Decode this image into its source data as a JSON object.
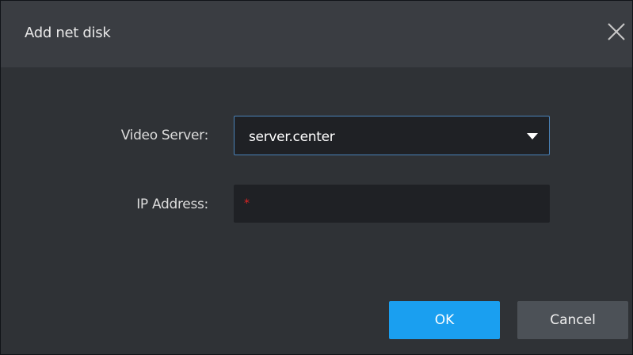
{
  "dialog": {
    "title": "Add net disk",
    "close_icon": "close-icon"
  },
  "form": {
    "video_server": {
      "label": "Video Server:",
      "selected": "server.center",
      "dropdown_icon": "caret-down-icon"
    },
    "ip_address": {
      "label": "IP Address:",
      "value": "",
      "required_marker": "*"
    }
  },
  "buttons": {
    "ok": "OK",
    "cancel": "Cancel"
  },
  "colors": {
    "dialog_bg": "#2f3236",
    "title_bar_bg": "#3a3d42",
    "input_bg": "#1f2125",
    "focus_border": "#4a82b8",
    "primary": "#1a9ff0",
    "secondary": "#4c5157",
    "required": "#e02424"
  }
}
